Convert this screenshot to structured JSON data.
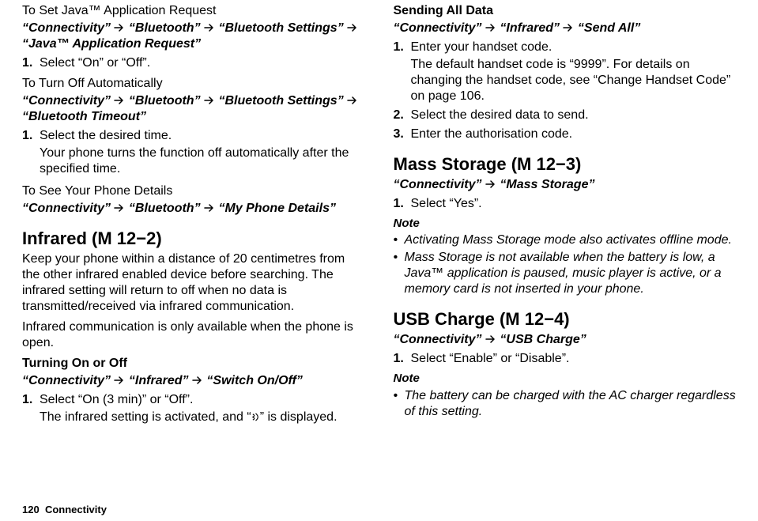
{
  "left": {
    "s1_head": "To Set Java™ Application Request",
    "s1_path_a": "“Connectivity”",
    "s1_path_b": "“Bluetooth”",
    "s1_path_c": "“Bluetooth Settings”",
    "s1_path_d": "“Java™ Application Request”",
    "s1_step1": "Select “On” or “Off”.",
    "s2_head": "To Turn Off Automatically",
    "s2_path_a": "“Connectivity”",
    "s2_path_b": "“Bluetooth”",
    "s2_path_c": "“Bluetooth Settings”",
    "s2_path_d": "“Bluetooth Timeout”",
    "s2_step1": "Select the desired time.",
    "s2_note": "Your phone turns the function off automatically after the specified time.",
    "s3_head": "To See Your Phone Details",
    "s3_path_a": "“Connectivity”",
    "s3_path_b": "“Bluetooth”",
    "s3_path_c": "“My Phone Details”",
    "h2_infrared": "Infrared",
    "h2_infrared_code": "(M 12−2)",
    "ir_para1": "Keep your phone within a distance of 20 centimetres from the other infrared enabled device before searching. The infrared setting will return to off when no data is transmitted/received via infrared communication.",
    "ir_para2": "Infrared communication is only available when the phone is open.",
    "ir_turn_head": "Turning On or Off",
    "ir_path_a": "“Connectivity”",
    "ir_path_b": "“Infrared”",
    "ir_path_c": "“Switch On/Off”",
    "ir_step1": "Select “On (3 min)” or “Off”.",
    "ir_step1_note_pre": "The infrared setting is activated, and “",
    "ir_step1_note_post": "” is displayed."
  },
  "right": {
    "send_head": "Sending All Data",
    "send_path_a": "“Connectivity”",
    "send_path_b": "“Infrared”",
    "send_path_c": "“Send All”",
    "send_step1": "Enter your handset code.",
    "send_step1_note": "The default handset code is “9999”. For details on changing the handset code, see “Change Handset Code” on page 106.",
    "send_step2": "Select the desired data to send.",
    "send_step3": "Enter the authorisation code.",
    "h2_mass": "Mass Storage",
    "h2_mass_code": "(M 12−3)",
    "mass_path_a": "“Connectivity”",
    "mass_path_b": "“Mass Storage”",
    "mass_step1": "Select “Yes”.",
    "note_label": "Note",
    "mass_bullet1": "Activating Mass Storage mode also activates offline mode.",
    "mass_bullet2": "Mass Storage is not available when the battery is low, a Java™ application is paused, music player is active, or a memory card is not inserted in your phone.",
    "h2_usb": "USB Charge",
    "h2_usb_code": "(M 12−4)",
    "usb_path_a": "“Connectivity”",
    "usb_path_b": "“USB Charge”",
    "usb_step1": "Select “Enable” or “Disable”.",
    "usb_bullet1": "The battery can be charged with the AC charger regardless of this setting."
  },
  "footer": {
    "page": "120",
    "section": "Connectivity"
  }
}
